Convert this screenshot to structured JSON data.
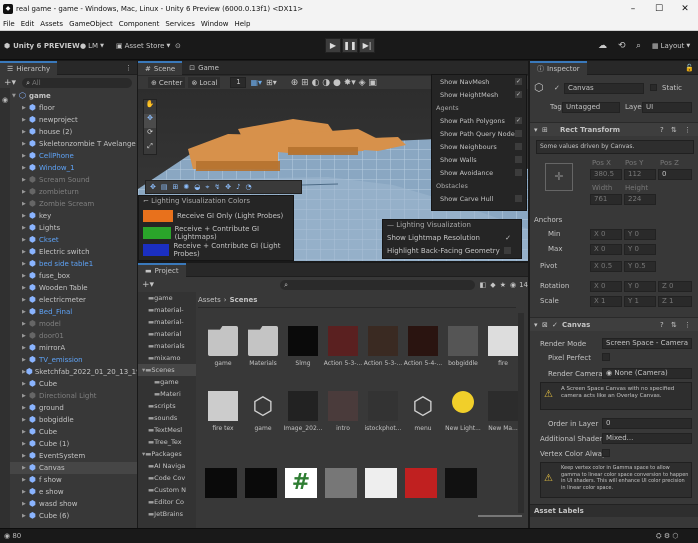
{
  "window": {
    "title": "real game - game - Windows, Mac, Linux - Unity 6 Preview (6000.0.13f1) <DX11>",
    "controls": [
      "–",
      "☐",
      "✕"
    ]
  },
  "menu": [
    "File",
    "Edit",
    "Assets",
    "GameObject",
    "Component",
    "Services",
    "Window",
    "Help"
  ],
  "toolbar": {
    "version": "Unity 6 PREVIEW",
    "account": "LM",
    "asset_store": "Asset Store",
    "layout": "Layout"
  },
  "hierarchy": {
    "tab": "Hierarchy",
    "search_placeholder": "All",
    "items": [
      {
        "label": "game",
        "depth": 0,
        "style": "bold",
        "expanded": true
      },
      {
        "label": "floor",
        "depth": 1,
        "style": "normal"
      },
      {
        "label": "newproject",
        "depth": 1,
        "style": "normal"
      },
      {
        "label": "house (2)",
        "depth": 1,
        "style": "normal"
      },
      {
        "label": "Skeletonzombie T Avelange",
        "depth": 1,
        "style": "normal"
      },
      {
        "label": "CellPhone",
        "depth": 1,
        "style": "blue"
      },
      {
        "label": "Window_1",
        "depth": 1,
        "style": "blue"
      },
      {
        "label": "Scream Sound",
        "depth": 1,
        "style": "gray"
      },
      {
        "label": "zombieturn",
        "depth": 1,
        "style": "gray"
      },
      {
        "label": "Zombie Scream",
        "depth": 1,
        "style": "gray"
      },
      {
        "label": "key",
        "depth": 1,
        "style": "normal"
      },
      {
        "label": "Lights",
        "depth": 1,
        "style": "normal"
      },
      {
        "label": "Ckset",
        "depth": 1,
        "style": "blue"
      },
      {
        "label": "Electric switch",
        "depth": 1,
        "style": "normal"
      },
      {
        "label": "bed side table1",
        "depth": 1,
        "style": "blue"
      },
      {
        "label": "fuse_box",
        "depth": 1,
        "style": "normal"
      },
      {
        "label": "Wooden Table",
        "depth": 1,
        "style": "normal"
      },
      {
        "label": "electricmeter",
        "depth": 1,
        "style": "normal"
      },
      {
        "label": "Bed_Final",
        "depth": 1,
        "style": "blue"
      },
      {
        "label": "model",
        "depth": 1,
        "style": "gray"
      },
      {
        "label": "door01",
        "depth": 1,
        "style": "gray"
      },
      {
        "label": "mirrorA",
        "depth": 1,
        "style": "normal"
      },
      {
        "label": "TV_emission",
        "depth": 1,
        "style": "blue"
      },
      {
        "label": "Sketchfab_2022_01_20_13_19_",
        "depth": 1,
        "style": "normal"
      },
      {
        "label": "Cube",
        "depth": 1,
        "style": "normal"
      },
      {
        "label": "Directional Light",
        "depth": 1,
        "style": "gray"
      },
      {
        "label": "ground",
        "depth": 1,
        "style": "normal"
      },
      {
        "label": "bobgiddle",
        "depth": 1,
        "style": "normal"
      },
      {
        "label": "Cube",
        "depth": 1,
        "style": "normal"
      },
      {
        "label": "Cube (1)",
        "depth": 1,
        "style": "normal"
      },
      {
        "label": "EventSystem",
        "depth": 1,
        "style": "normal"
      },
      {
        "label": "Canvas",
        "depth": 1,
        "style": "selected"
      },
      {
        "label": "f show",
        "depth": 1,
        "style": "normal"
      },
      {
        "label": "e show",
        "depth": 1,
        "style": "normal"
      },
      {
        "label": "wasd show",
        "depth": 1,
        "style": "normal"
      },
      {
        "label": "Cube (6)",
        "depth": 1,
        "style": "normal"
      }
    ]
  },
  "scene": {
    "tabs": [
      "Scene",
      "Game"
    ],
    "center_label": "Center",
    "local_label": "Local",
    "grid_value": "1",
    "overlay_menu": [
      "Show NavMesh",
      "Show HeightMesh",
      "Agents",
      "Show Path Polygons",
      "Show Path Query Nodes",
      "Show Neighbours",
      "Show Walls",
      "Show Avoidance",
      "Obstacles",
      "Show Carve Hull"
    ],
    "lighting_colors": {
      "title": "Lighting Visualization Colors",
      "items": [
        {
          "label": "Receive GI Only (Light Probes)",
          "color": "#e8711c"
        },
        {
          "label": "Receive + Contribute GI (Lightmaps)",
          "color": "#2aa52a"
        },
        {
          "label": "Receive + Contribute GI (Light Probes)",
          "color": "#1b2fc2"
        }
      ]
    },
    "lighting_vis": {
      "title": "Lighting Visualization",
      "rows": [
        "Show Lightmap Resolution",
        "Highlight Back-Facing Geometry"
      ]
    }
  },
  "project": {
    "tab": "Project",
    "breadcrumb": [
      "Assets",
      "Scenes"
    ],
    "count": "14",
    "tree": [
      "game",
      "material-",
      "material-",
      "material",
      "materials",
      "mixamo",
      "Scenes",
      "game",
      "Materi",
      "scripts",
      "sounds",
      "TextMesl",
      "Tree_Tex",
      "Packages",
      "AI Naviga",
      "Code Cov",
      "Custom N",
      "Editor Co",
      "JetBrains"
    ],
    "assets_row1": [
      "game",
      "Materials",
      "Slmg",
      "Action 5-3-...",
      "Action 5-3-...",
      "Action 5-4-...",
      "bobgiddle",
      "fire"
    ],
    "assets_row2": [
      "fire tex",
      "game",
      "Image_202...",
      "intro",
      "istockphot...",
      "menu",
      "New Light...",
      "New Ma..."
    ]
  },
  "inspector": {
    "tab": "Inspector",
    "object_name": "Canvas",
    "static_label": "Static",
    "tag_label": "Tag",
    "tag_value": "Untagged",
    "layer_label": "Layer",
    "layer_value": "UI",
    "rect_transform": "Rect Transform",
    "driven_note": "Some values driven by Canvas.",
    "pos_headers": [
      "Pos X",
      "Pos Y",
      "Pos Z"
    ],
    "pos_values": [
      "380.5",
      "112",
      "0"
    ],
    "size_headers": [
      "Width",
      "Height"
    ],
    "size_values": [
      "761",
      "224"
    ],
    "anchors": "Anchors",
    "anchor_min": "Min",
    "anchor_max": "Max",
    "pivot": "Pivot",
    "rotation": "Rotation",
    "scale": "Scale",
    "min_vals": [
      "0",
      "0"
    ],
    "max_vals": [
      "0",
      "0"
    ],
    "pivot_vals": [
      "0.5",
      "0.5"
    ],
    "rot_vals": [
      "0",
      "0",
      "0"
    ],
    "scale_vals": [
      "1",
      "1",
      "1"
    ],
    "canvas": "Canvas",
    "render_mode_label": "Render Mode",
    "render_mode_value": "Screen Space - Camera",
    "pixel_perfect": "Pixel Perfect",
    "render_camera_label": "Render Camera",
    "render_camera_value": "None (Camera)",
    "camera_note": "A Screen Space Canvas with no specified camera acts like an Overlay Canvas.",
    "order_label": "Order in Layer",
    "order_value": "0",
    "shader_label": "Additional Shader Ch",
    "shader_value": "Mixed...",
    "vertex_label": "Vertex Color Always",
    "vertex_note": "Keep vertex color in Gamma space to allow gamma to linear color space conversion to happen in UI shaders. This will enhance UI color precision in linear color space.",
    "asset_labels": "Asset Labels"
  },
  "status": {
    "left": "80"
  }
}
